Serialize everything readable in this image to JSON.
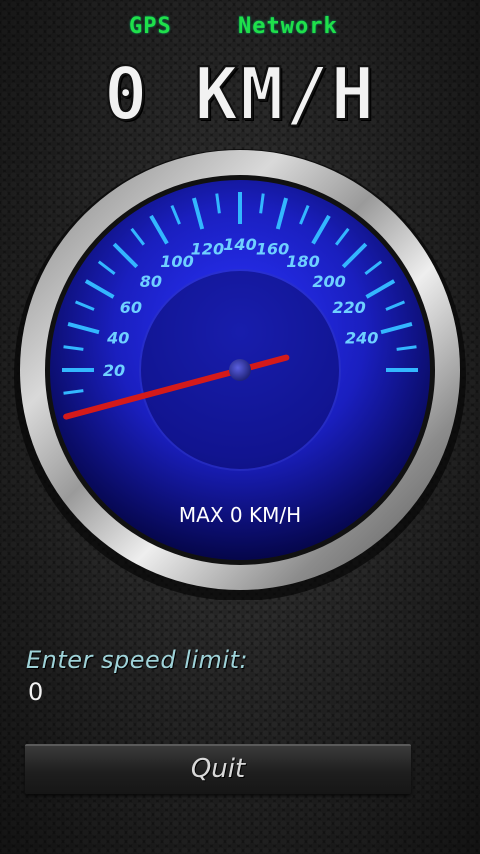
{
  "status": {
    "gps_label": "GPS",
    "network_label": "Network",
    "gps_color": "#1fe04a",
    "network_color": "#1fe04a"
  },
  "speed": {
    "value": 0,
    "unit": "KM/H",
    "display": "0 KM/H"
  },
  "gauge": {
    "max_label": "MAX 0 KM/H",
    "tick_labels": [
      "20",
      "40",
      "60",
      "80",
      "100",
      "120",
      "140",
      "160",
      "180",
      "200",
      "220",
      "240"
    ],
    "needle_speed": 0,
    "face_color": "#1a1fd0",
    "tick_color": "#33b7ff",
    "needle_color": "#d41a1a"
  },
  "speed_limit": {
    "label": "Enter speed limit:",
    "value": "0"
  },
  "quit_button": {
    "label": "Quit"
  }
}
